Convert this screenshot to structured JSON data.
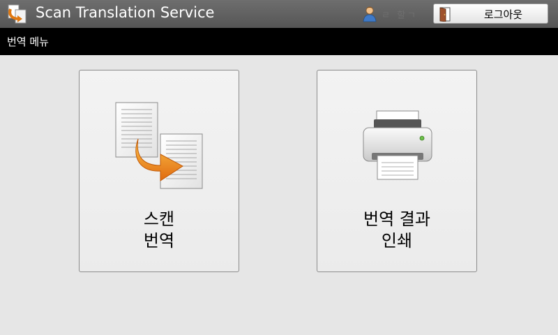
{
  "header": {
    "title": "Scan Translation Service",
    "user_status": "ㄹ 할ㄱ",
    "logout_label": "로그아웃"
  },
  "menubar": {
    "label": "번역 메뉴"
  },
  "tiles": [
    {
      "line1": "스캔",
      "line2": "번역",
      "icon": "document-translate-icon"
    },
    {
      "line1": "번역 결과",
      "line2": "인쇄",
      "icon": "printer-icon"
    }
  ],
  "colors": {
    "titlebar": "#606060",
    "menubar": "#000000",
    "background": "#e6e6e6",
    "accent_orange": "#f08c1e"
  }
}
